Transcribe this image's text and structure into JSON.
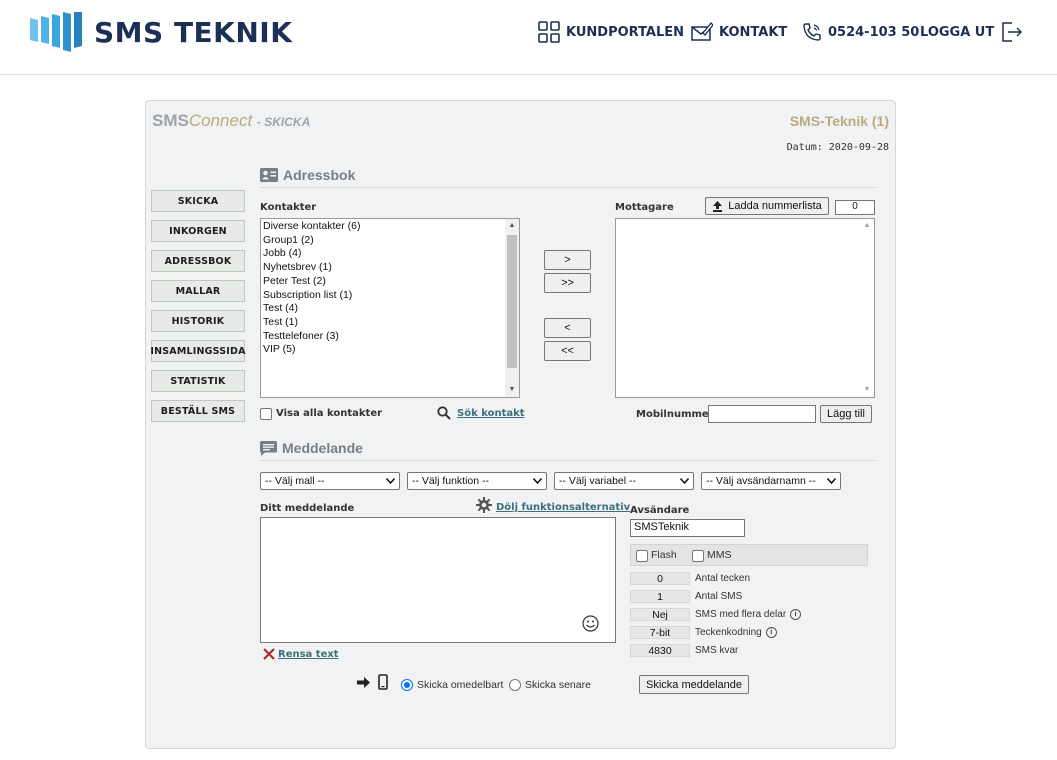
{
  "header": {
    "logo_text": "SMS TEKNIK",
    "nav": {
      "portal": "KUNDPORTALEN",
      "contact": "KONTAKT",
      "phone": "0524-103 50",
      "logout": "LOGGA UT"
    }
  },
  "panel": {
    "brand_sms": "SMS",
    "brand_connect": "Connect",
    "brand_suffix": "- SKICKA",
    "account": "SMS-Teknik (1)",
    "date": "Datum: 2020-09-28"
  },
  "menu": [
    "SKICKA",
    "INKORGEN",
    "ADRESSBOK",
    "MALLAR",
    "HISTORIK",
    "INSAMLINGSSIDA",
    "STATISTIK",
    "BESTÄLL SMS"
  ],
  "addressbook": {
    "title": "Adressbok",
    "contacts_label": "Kontakter",
    "contacts": [
      "Diverse kontakter (6)",
      "Group1 (2)",
      "Jobb (4)",
      "Nyhetsbrev (1)",
      "Peter Test (2)",
      "Subscription list (1)",
      "Test (4)",
      "Test (1)",
      "Testtelefoner (3)",
      "VIP (5)"
    ],
    "recipients_label": "Mottagare",
    "upload_button": "Ladda nummerlista",
    "recipient_count": "0",
    "move_buttons": [
      ">",
      ">>",
      "<",
      "<<"
    ],
    "show_all_label": "Visa alla kontakter",
    "search_link": "Sök kontakt",
    "mobile_label": "Mobilnummer",
    "mobile_value": "",
    "add_button": "Lägg till"
  },
  "message": {
    "title": "Meddelande",
    "selects": [
      "-- Välj mall --",
      "-- Välj funktion --",
      "-- Välj variabel --",
      "-- Välj avsändarnamn --"
    ],
    "your_message_label": "Ditt meddelande",
    "hide_options_link": "Dölj funktionsalternativ",
    "message_text": "",
    "clear_link": "Rensa text",
    "sender_label": "Avsändare",
    "sender_value": "SMSTeknik",
    "flash_label": "Flash",
    "mms_label": "MMS",
    "stats": [
      {
        "value": "0",
        "label": "Antal tecken"
      },
      {
        "value": "1",
        "label": "Antal SMS"
      },
      {
        "value": "Nej",
        "label": "SMS med flera delar"
      },
      {
        "value": "7-bit",
        "label": "Teckenkodning"
      },
      {
        "value": "4830",
        "label": "SMS kvar"
      }
    ],
    "send_now_label": "Skicka omedelbart",
    "send_later_label": "Skicka senare",
    "send_button": "Skicka meddelande"
  },
  "colors": {
    "brand_navy": "#1c2f55",
    "brand_blue": "#3aa6dd",
    "accent_gold": "#b7ac7d",
    "link_teal": "#3e6f7c"
  }
}
